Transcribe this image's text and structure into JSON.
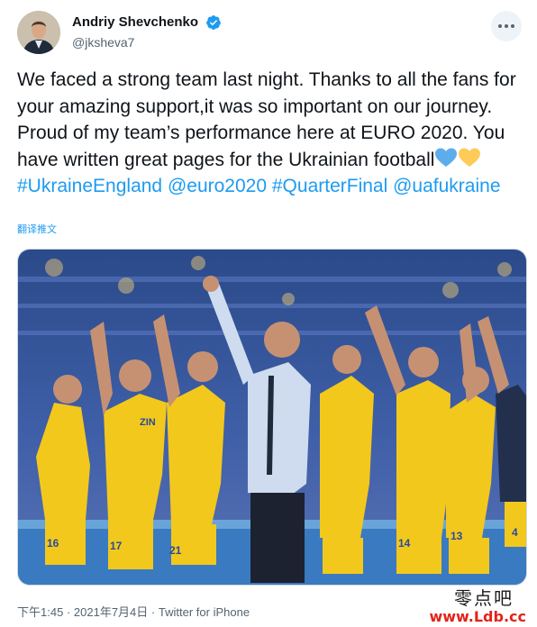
{
  "author": {
    "display_name": "Andriy Shevchenko",
    "handle": "@jksheva7",
    "verified_icon": "verified-badge-icon",
    "avatar_icon": "profile-photo"
  },
  "more_button_icon": "more-dots-icon",
  "tweet": {
    "text_1": "We faced a strong team last night. Thanks to all the fans for your amazing support,it was so important on our journey. Proud of my team’s performance here at EURO 2020. You have written great pages for the Ukrainian football",
    "emoji_1": "blue-heart",
    "emoji_2": "yellow-heart",
    "hashtag_1": "#UkraineEngland",
    "mention_1": "@euro2020",
    "hashtag_2": "#QuarterFinal",
    "mention_2": "@uafukraine"
  },
  "translate_label": "翻译推文",
  "media": {
    "description_icon": "team-photo",
    "shirt_numbers": [
      "16",
      "17",
      "21",
      "14",
      "13",
      "4"
    ],
    "shirt_name": "ZIN"
  },
  "meta": {
    "time": "下午1:45",
    "separator": "·",
    "date": "2021年7月4日",
    "source": "Twitter for iPhone"
  },
  "watermark": {
    "line_1": "零点吧",
    "line_2": "www.Ldb.cc"
  },
  "colors": {
    "link": "#1d9bf0",
    "text": "#0f1419",
    "secondary": "#536471",
    "heart_blue": "#5dadec",
    "heart_yellow": "#fdcb58",
    "watermark_red": "#e2231a"
  }
}
